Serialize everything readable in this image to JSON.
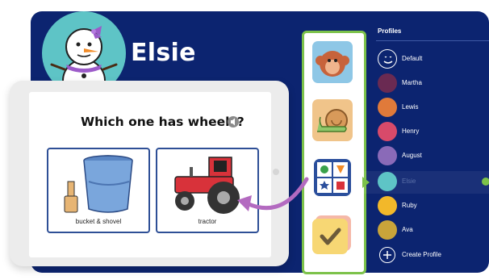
{
  "header": {
    "name": "Elsie"
  },
  "question": {
    "text": "Which one has wheels?",
    "speaker_icon": "speaker-icon"
  },
  "choices": [
    {
      "label": "bucket & shovel",
      "icon": "bucket-shovel-illustration"
    },
    {
      "label": "tractor",
      "icon": "tractor-illustration"
    }
  ],
  "apps": [
    {
      "icon": "monkey-app-icon"
    },
    {
      "icon": "snail-app-icon"
    },
    {
      "icon": "shapes-grid-app-icon"
    },
    {
      "icon": "checkmark-app-icon"
    }
  ],
  "profiles": {
    "header": "Profiles",
    "items": [
      {
        "name": "Default",
        "selected": false
      },
      {
        "name": "Martha",
        "selected": false
      },
      {
        "name": "Lewis",
        "selected": false
      },
      {
        "name": "Henry",
        "selected": false
      },
      {
        "name": "August",
        "selected": false
      },
      {
        "name": "Elsie",
        "selected": true
      },
      {
        "name": "Ruby",
        "selected": false
      },
      {
        "name": "Ava",
        "selected": false
      }
    ],
    "create_label": "Create Profile"
  },
  "colors": {
    "panel_blue": "#0c2470",
    "accent_green": "#7cc24a",
    "avatar_teal": "#5ec4c6",
    "card_border": "#2e4f96",
    "arrow_purple": "#b36ac0"
  }
}
